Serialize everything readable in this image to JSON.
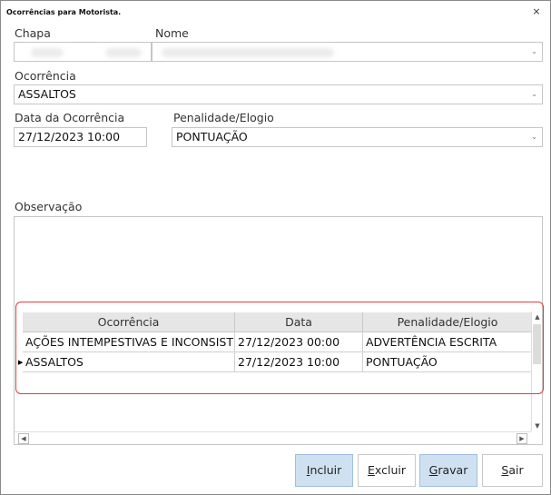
{
  "window": {
    "title": "Ocorrências para Motorista.",
    "close_glyph": "×"
  },
  "labels": {
    "chapa": "Chapa",
    "nome": "Nome",
    "ocorrencia": "Ocorrência",
    "data": "Data da Ocorrência",
    "penalidade": "Penalidade/Elogio",
    "observacao": "Observação"
  },
  "fields": {
    "chapa_value": "",
    "nome_value": "",
    "ocorrencia_value": "ASSALTOS",
    "data_value": "27/12/2023 10:00",
    "penalidade_value": "PONTUAÇÃO"
  },
  "grid": {
    "columns": [
      "Ocorrência",
      "Data",
      "Penalidade/Elogio"
    ],
    "rows": [
      {
        "ocorrencia": "AÇÕES INTEMPESTIVAS E INCONSIST",
        "data": "27/12/2023 00:00",
        "penalidade": "ADVERTÊNCIA ESCRITA",
        "current": false
      },
      {
        "ocorrencia": "ASSALTOS",
        "data": "27/12/2023 10:00",
        "penalidade": "PONTUAÇÃO",
        "current": true
      }
    ]
  },
  "buttons": {
    "incluir_first": "I",
    "incluir_rest": "ncluir",
    "excluir_first": "E",
    "excluir_rest": "xcluir",
    "gravar_first": "G",
    "gravar_rest": "ravar",
    "sair_first": "S",
    "sair_rest": "air"
  },
  "colors": {
    "highlight": "#e53b3b",
    "button_active_bg": "#cfe1f1",
    "grid_header_bg": "#e6e6e6"
  }
}
